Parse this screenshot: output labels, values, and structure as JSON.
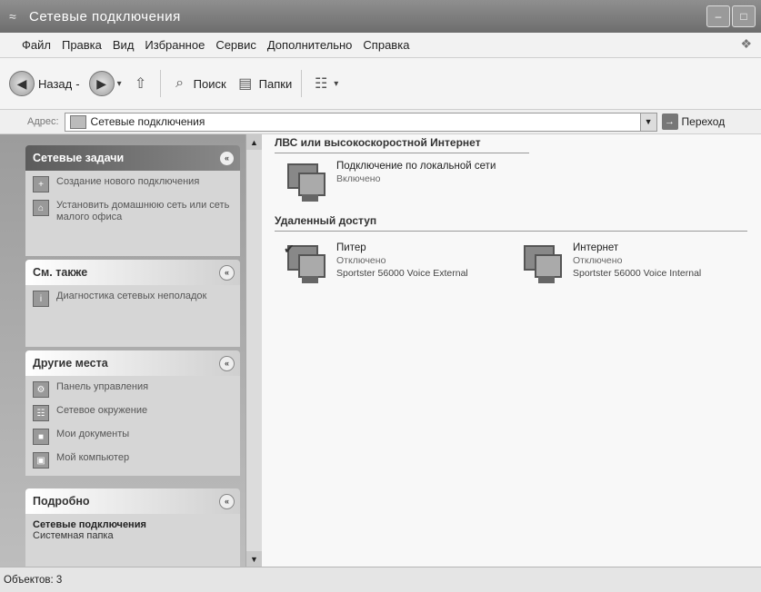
{
  "window": {
    "title": "Сетевые подключения"
  },
  "menu": [
    "Файл",
    "Правка",
    "Вид",
    "Избранное",
    "Сервис",
    "Дополнительно",
    "Справка"
  ],
  "toolbar": {
    "back_label": "Назад",
    "search_label": "Поиск",
    "folders_label": "Папки"
  },
  "address": {
    "label": "Адрес:",
    "value": "Сетевые подключения",
    "go_label": "Переход"
  },
  "sidebar": {
    "network_tasks": {
      "header": "Сетевые задачи",
      "items": [
        "Создание нового подключения",
        "Установить домашнюю сеть или сеть малого офиса"
      ]
    },
    "see_also": {
      "header": "См. также",
      "items": [
        "Диагностика сетевых неполадок"
      ]
    },
    "other_places": {
      "header": "Другие места",
      "items": [
        "Панель управления",
        "Сетевое окружение",
        "Мои документы",
        "Мой компьютер"
      ]
    },
    "details": {
      "header": "Подробно",
      "title": "Сетевые подключения",
      "subtitle": "Системная папка"
    }
  },
  "groups": [
    {
      "heading": "ЛВС или высокоскоростной Интернет",
      "connections": [
        {
          "name": "Подключение по локальной сети",
          "status": "Включено",
          "device": ""
        }
      ]
    },
    {
      "heading": "Удаленный доступ",
      "connections": [
        {
          "name": "Питер",
          "status": "Отключено",
          "device": "Sportster 56000 Voice External"
        },
        {
          "name": "Интернет",
          "status": "Отключено",
          "device": "Sportster 56000 Voice Internal"
        }
      ]
    }
  ],
  "status_bar": {
    "text": "Объектов: 3"
  }
}
